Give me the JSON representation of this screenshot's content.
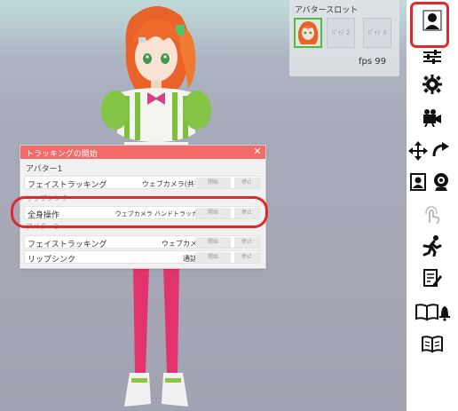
{
  "slot_panel": {
    "title": "アバタースロット",
    "slots": [
      "",
      "ﾊﾟｲﾃ 2",
      "ﾊﾟｲﾃ 3"
    ]
  },
  "fps": "fps 99",
  "dialog": {
    "title": "トラッキングの開始",
    "close": "✕",
    "section1": "アバター1",
    "row1": {
      "name": "フェイストラッキング",
      "device": "ウェブカメラ(共有)",
      "start": "開始",
      "stop": "停止"
    },
    "ghost1": "リップシンク",
    "row_full": {
      "name": "全身操作",
      "device": "ウェブカメラ ハンドトラッカー",
      "start": "開始",
      "stop": "停止"
    },
    "ghost2": "アバター2",
    "row2": {
      "name": "フェイストラッキング",
      "device": "ウェブカメラ",
      "start": "開始",
      "stop": "停止"
    },
    "row3": {
      "name": "リップシンク",
      "device": "通話音",
      "start": "開始",
      "stop": "停止"
    }
  },
  "toolbar": {
    "icons": [
      "avatar-icon",
      "sliders-icon",
      "gear-icon",
      "camera-icon",
      "move-icon",
      "rotate-icon",
      "portrait-icon",
      "webcam-icon",
      "touch-icon",
      "pose-icon",
      "note-icon",
      "book-bell-icon",
      "book-icon"
    ]
  },
  "colors": {
    "accent": "#f26b6b",
    "highlight": "#e0292c",
    "slot_active": "#53b943"
  }
}
